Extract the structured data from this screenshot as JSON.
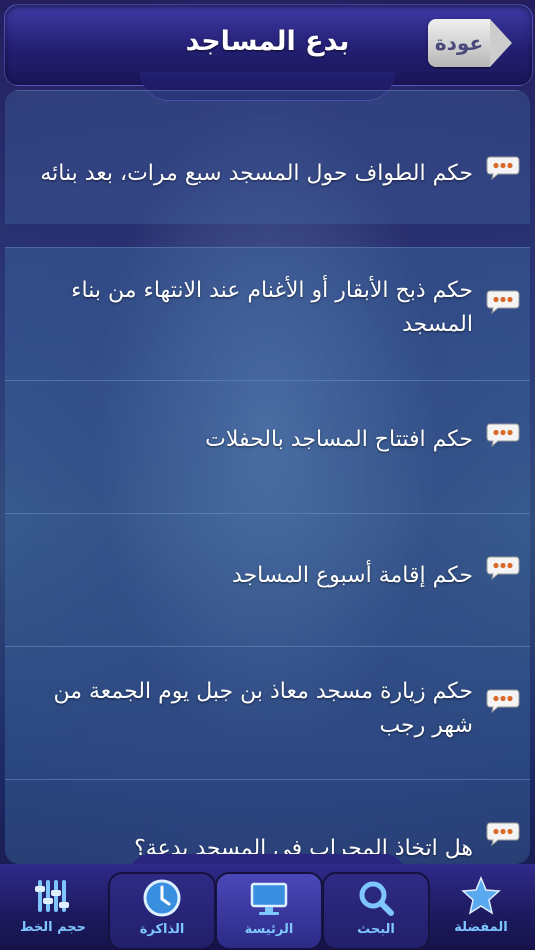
{
  "header": {
    "title": "بدع المساجد",
    "back_label": "عودة"
  },
  "items": [
    {
      "text": "حكم الطواف حول المسجد سبع مرات، بعد بنائه"
    },
    {
      "text": "حكم ذبح الأبقار أو الأغنام عند الانتهاء من بناء المسجد"
    },
    {
      "text": "حكم افتتاح المساجد بالحفلات"
    },
    {
      "text": "حكم إقامة أسبوع المساجد"
    },
    {
      "text": "حكم زيارة مسجد معاذ بن جبل يوم الجمعة من شهر رجب"
    },
    {
      "text": "هل اتخاذ المحراب في المسجد بدعة؟"
    }
  ],
  "tabs": [
    {
      "label": "حجم الخط",
      "icon": "sliders-icon"
    },
    {
      "label": "الذاكرة",
      "icon": "clock-icon"
    },
    {
      "label": "الرئيسة",
      "icon": "monitor-icon",
      "active": true
    },
    {
      "label": "البحث",
      "icon": "search-icon"
    },
    {
      "label": "المفضلة",
      "icon": "star-icon"
    }
  ],
  "colors": {
    "tab_label": "#7fc6ff",
    "bubble_dots": "#d86a2a"
  }
}
